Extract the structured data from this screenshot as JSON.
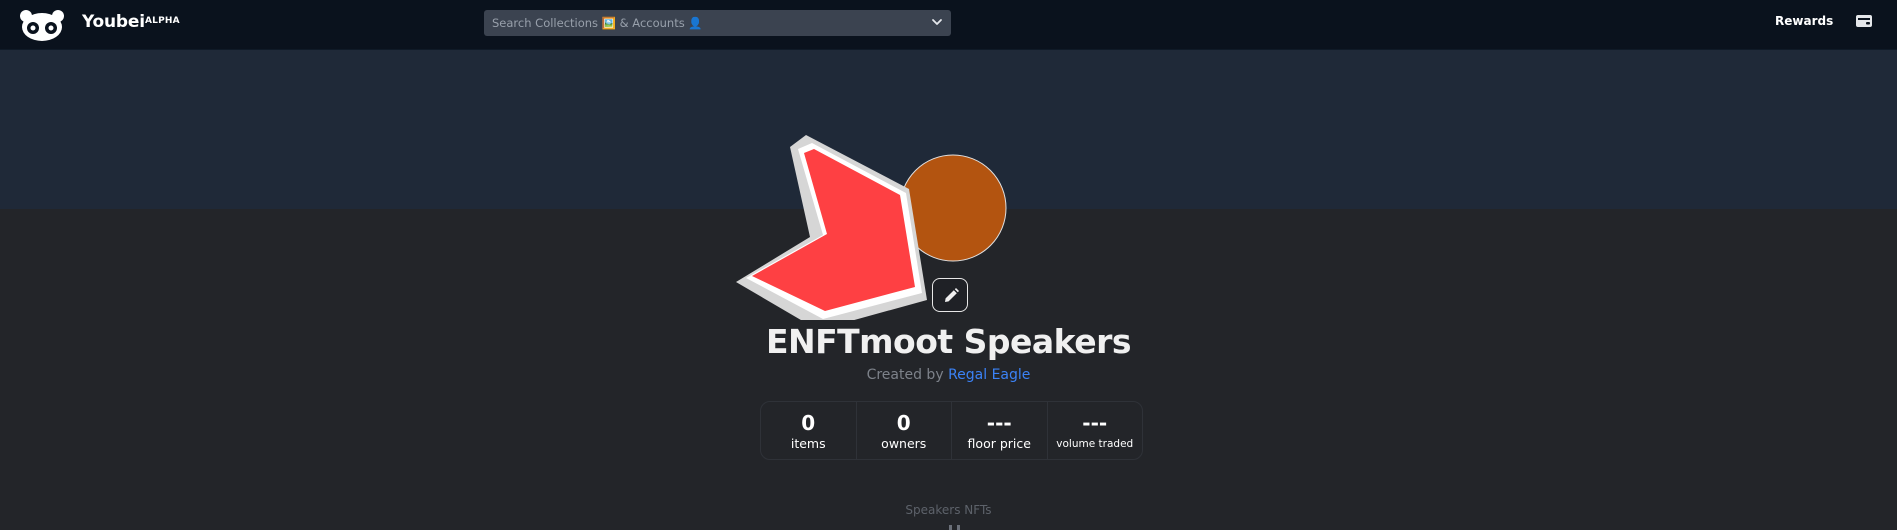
{
  "header": {
    "brand": "Youbei",
    "badge": "ALPHA",
    "search_placeholder": "Search Collections 🖼️ & Accounts 👤",
    "rewards_label": "Rewards",
    "icons": [
      "panda-logo-icon",
      "chevron-down-icon",
      "wallet-icon"
    ]
  },
  "collection": {
    "title": "ENFTmoot Speakers",
    "created_by_prefix": "Created by",
    "creator": "Regal Eagle",
    "edit_icon": "pencil-icon"
  },
  "stats": [
    {
      "value": "0",
      "label": "items"
    },
    {
      "value": "0",
      "label": "owners"
    },
    {
      "value": "---",
      "label": "floor price"
    },
    {
      "value": "---",
      "label": "volume traded"
    }
  ],
  "section": {
    "label": "Speakers NFTs"
  },
  "colors": {
    "topbar": "#0a121d",
    "banner": "#1f2938",
    "page": "#232529",
    "accent_link": "#3b82f6",
    "shape_red": "#fe4043",
    "shape_brown": "#b35410"
  }
}
